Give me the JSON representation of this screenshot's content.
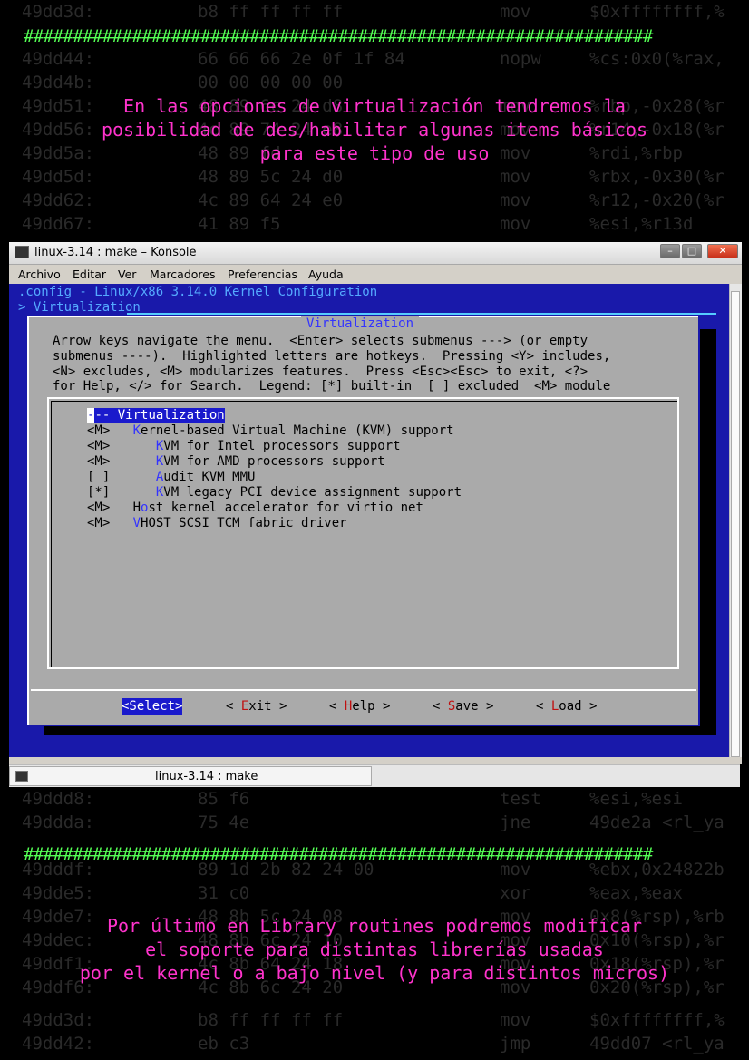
{
  "background_asm": [
    [
      "49dd3d:",
      "b8 ff ff ff ff",
      "mov",
      "$0xffffffff,%"
    ],
    [
      "49dd44:",
      "66 66 66 2e 0f 1f 84",
      "nopw",
      "%cs:0x0(%rax,"
    ],
    [
      "49dd4b:",
      "00 00 00 00 00",
      "",
      ""
    ],
    [
      "49dd51:",
      "48 89 6c 24 d8",
      "mov",
      "%rbp,-0x28(%r"
    ],
    [
      "49dd56:",
      "4c 89 74 24 e8",
      "mov",
      "%r14,-0x18(%r"
    ],
    [
      "49dd5a:",
      "48 89 fd",
      "mov",
      "%rdi,%rbp"
    ],
    [
      "49dd5d:",
      "48 89 5c 24 d0",
      "mov",
      "%rbx,-0x30(%r"
    ],
    [
      "49dd62:",
      "4c 89 64 24 e0",
      "mov",
      "%r12,-0x20(%r"
    ],
    [
      "49dd67:",
      "41 89 f5",
      "mov",
      "%esi,%r13d"
    ],
    [
      "49ddd8:",
      "85 f6",
      "test",
      "%esi,%esi"
    ],
    [
      "49ddda:",
      "75 4e",
      "jne",
      "49de2a <rl_ya"
    ],
    [
      "49dddf:",
      "89 1d 2b 82 24 00",
      "mov",
      "%ebx,0x24822b"
    ],
    [
      "49dde5:",
      "31 c0",
      "xor",
      "%eax,%eax"
    ],
    [
      "49dde7:",
      "48 8b 5c 24 08",
      "mov",
      "0x8(%rsp),%rb"
    ],
    [
      "49ddec:",
      "48 8b 6c 24 10",
      "mov",
      "0x10(%rsp),%r"
    ],
    [
      "49ddf1:",
      "4c 8b 64 24 18",
      "mov",
      "0x18(%rsp),%r"
    ],
    [
      "49ddf6:",
      "4c 8b 6c 24 20",
      "mov",
      "0x20(%rsp),%r"
    ],
    [
      "49dd3d:",
      "b8 ff ff ff ff",
      "mov",
      "$0xffffffff,%"
    ],
    [
      "49dd42:",
      "eb c3",
      "jmp",
      "49dd07 <rl_ya"
    ]
  ],
  "hash_bar": "################################################################",
  "caption_top": "En las opciones de virtualización tendremos la\nposibilidad de des/habilitar algunas items básicos\npara este tipo de uso",
  "caption_bottom": "Por último en Library routines podremos modificar\nel soporte para distintas librerías usadas\npor el kernel o a bajo nivel (y para distintos micros)",
  "window": {
    "title": "linux-3.14 : make – Konsole",
    "menu": [
      "Archivo",
      "Editar",
      "Ver",
      "Marcadores",
      "Preferencias",
      "Ayuda"
    ]
  },
  "terminal": {
    "header_line1": ".config - Linux/x86 3.14.0 Kernel Configuration",
    "header_line2": "> Virtualization",
    "dialog_title": "Virtualization",
    "help_text": "Arrow keys navigate the menu.  <Enter> selects submenus ---> (or empty\nsubmenus ----).  Highlighted letters are hotkeys.  Pressing <Y> includes,\n<N> excludes, <M> modularizes features.  Press <Esc><Esc> to exit, <?>\nfor Help, </> for Search.  Legend: [*] built-in  [ ] excluded  <M> module",
    "items": [
      {
        "prefix": "",
        "sel_hk": "-",
        "rest": "-- Virtualization",
        "selected": true
      },
      {
        "prefix": "<M>   ",
        "hk": "K",
        "rest": "ernel-based Virtual Machine (KVM) support"
      },
      {
        "prefix": "<M>      ",
        "hk": "K",
        "rest": "VM for Intel processors support"
      },
      {
        "prefix": "<M>      ",
        "hk": "K",
        "rest": "VM for AMD processors support"
      },
      {
        "prefix": "[ ]      ",
        "hk": "A",
        "rest": "udit KVM MMU"
      },
      {
        "prefix": "[*]      ",
        "hk": "K",
        "rest": "VM legacy PCI device assignment support"
      },
      {
        "prefix": "<M>   H",
        "hk": "o",
        "rest": "st kernel accelerator for virtio net"
      },
      {
        "prefix": "<M>   ",
        "hk": "V",
        "rest": "HOST_SCSI TCM fabric driver"
      }
    ],
    "buttons": [
      {
        "label": "<Select>",
        "selected": true
      },
      {
        "pre": "< ",
        "hk": "E",
        "rest": "xit >"
      },
      {
        "pre": "< ",
        "hk": "H",
        "rest": "elp >"
      },
      {
        "pre": "< ",
        "hk": "S",
        "rest": "ave >"
      },
      {
        "pre": "< ",
        "hk": "L",
        "rest": "oad >"
      }
    ]
  },
  "taskbar": {
    "task_label": "linux-3.14 : make"
  },
  "colors": {
    "caption": "#ff33cc",
    "hash": "#55ff55",
    "terminal_bg": "#1919aa",
    "dialog_bg": "#aaaaaa"
  }
}
